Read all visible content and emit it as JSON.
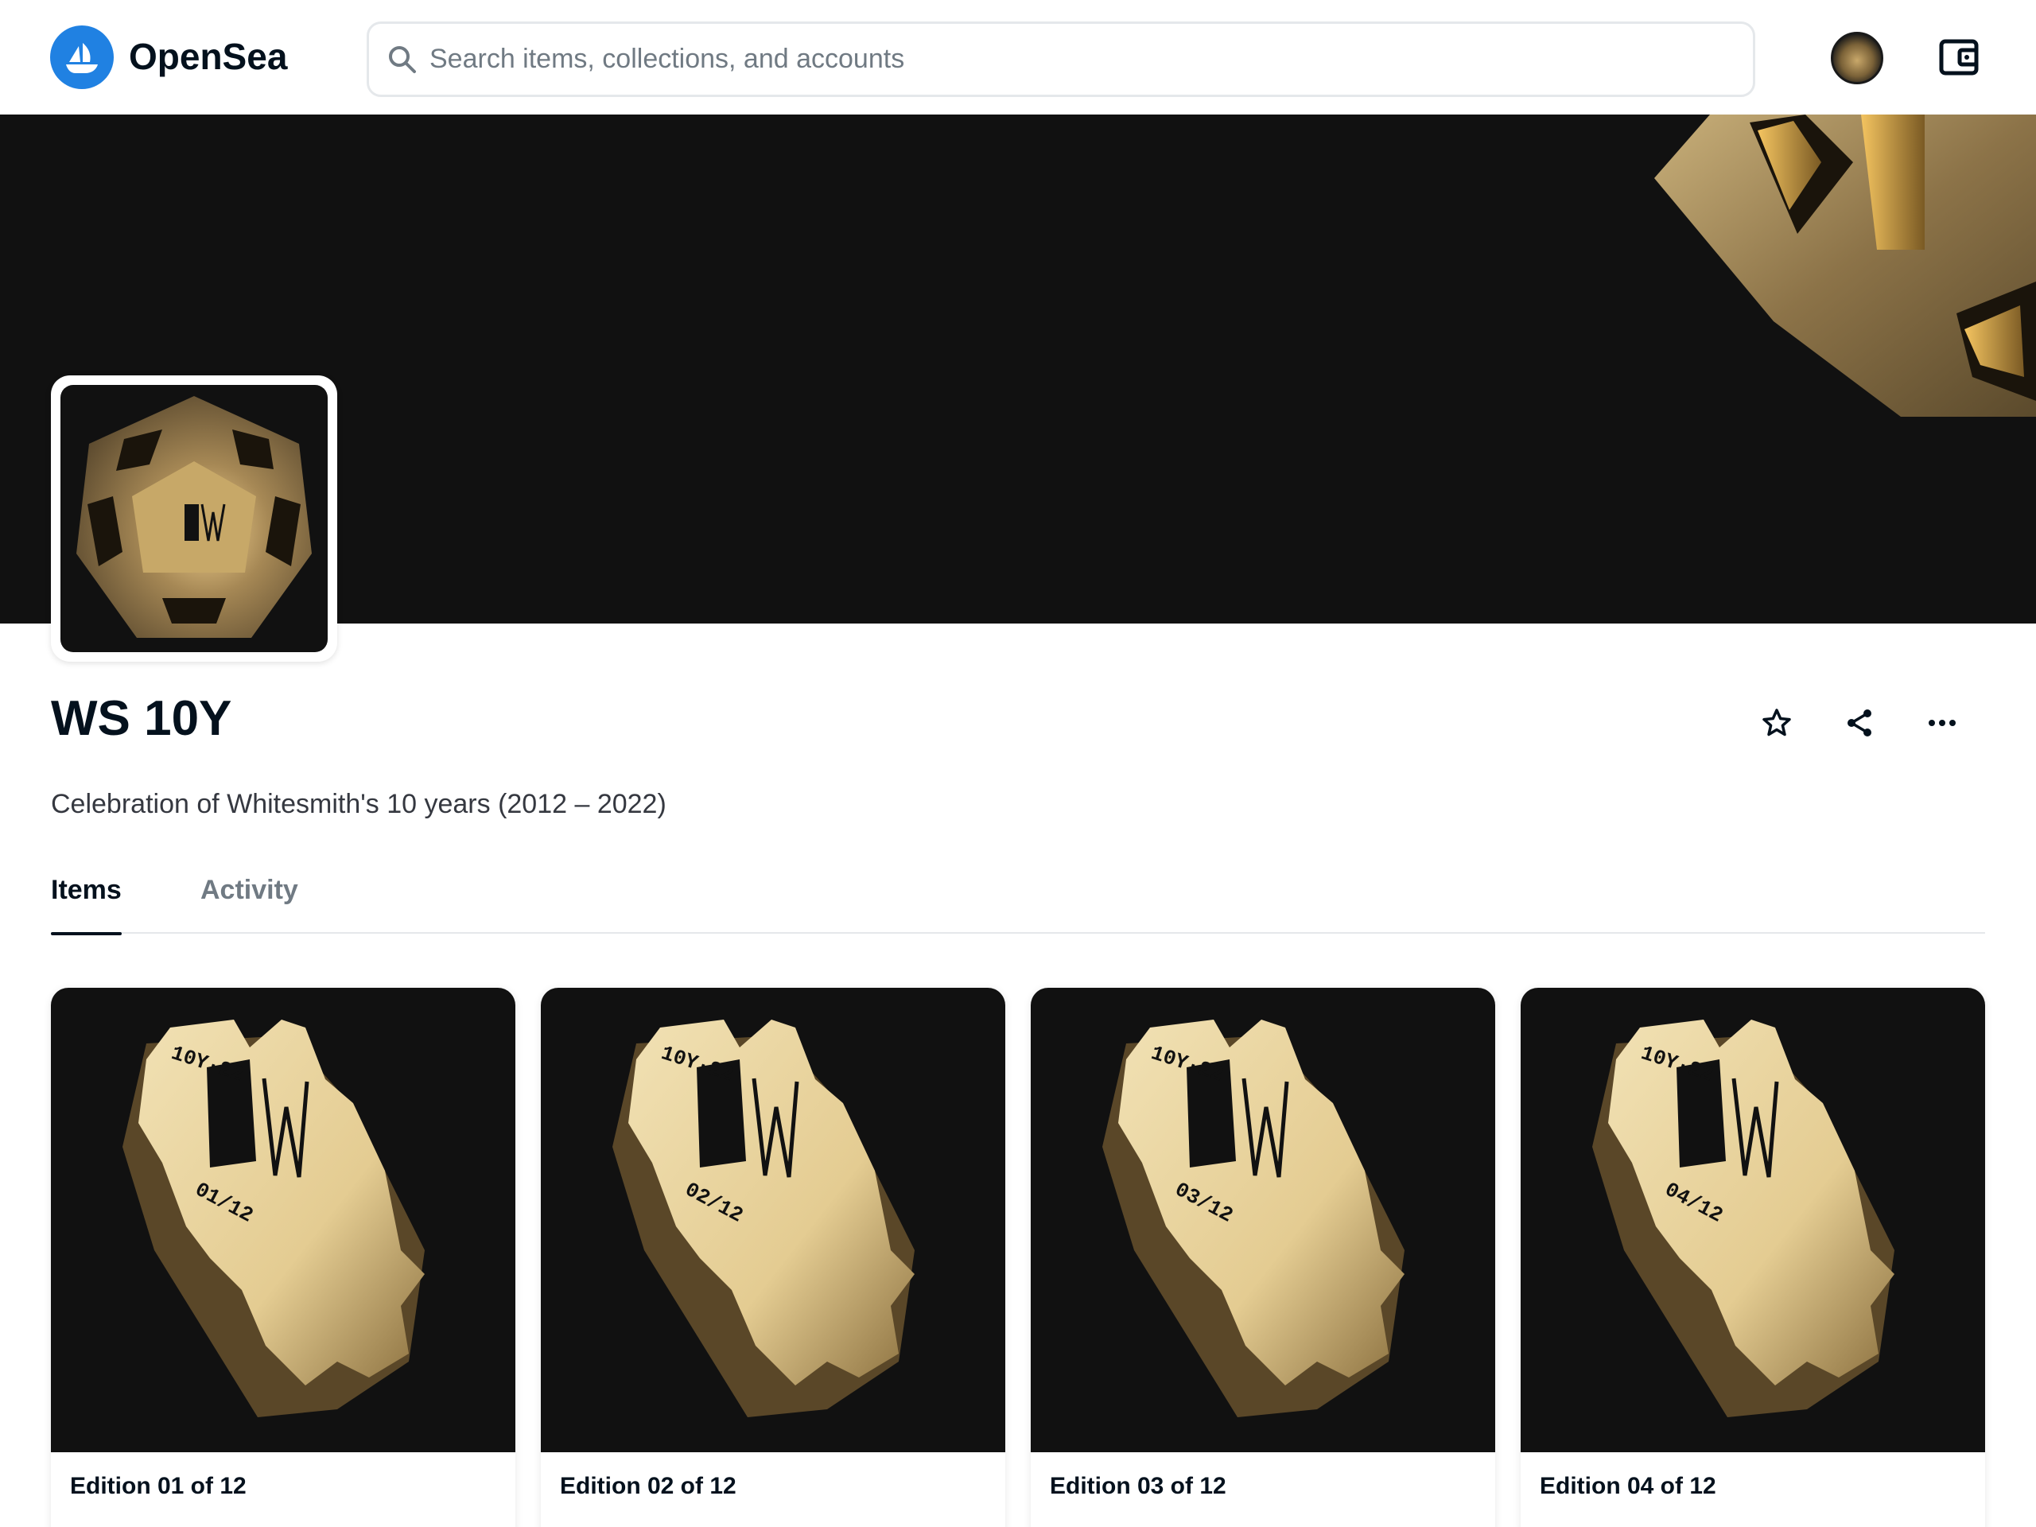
{
  "header": {
    "brand": "OpenSea",
    "search_placeholder": "Search items, collections, and accounts"
  },
  "collection": {
    "name": "WS 10Y",
    "description": "Celebration of Whitesmith's 10 years (2012 – 2022)"
  },
  "tabs": [
    {
      "label": "Items",
      "active": true
    },
    {
      "label": "Activity",
      "active": false
    }
  ],
  "items": [
    {
      "title": "Edition 01 of 12",
      "edition_mark": "01/12"
    },
    {
      "title": "Edition 02 of 12",
      "edition_mark": "02/12"
    },
    {
      "title": "Edition 03 of 12",
      "edition_mark": "03/12"
    },
    {
      "title": "Edition 04 of 12",
      "edition_mark": "04/12"
    }
  ],
  "colors": {
    "brand_blue": "#2081e2",
    "text_primary": "#04111d",
    "text_secondary": "#707a83",
    "banner_bg": "#111111",
    "gold": "#d9c28f"
  },
  "icons": {
    "logo": "opensea-boat-icon",
    "search": "search-icon",
    "avatar": "avatar",
    "wallet": "wallet-icon",
    "favorite": "star-icon",
    "share": "share-icon",
    "more": "more-dots-icon"
  }
}
